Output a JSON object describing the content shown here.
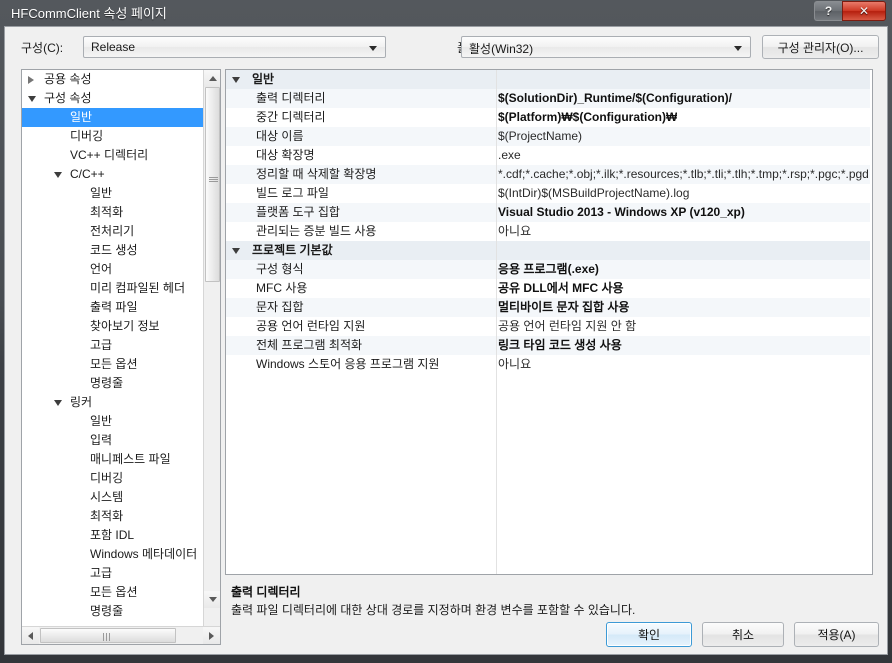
{
  "window": {
    "title": "HFCommClient 속성 페이지",
    "help_label": "?",
    "close_label": "✕"
  },
  "top": {
    "config_label": "구성(C):",
    "config_value": "Release",
    "platform_label": "플랫폼(P):",
    "platform_value": "활성(Win32)",
    "config_manager_label": "구성 관리자(O)..."
  },
  "tree": {
    "items": [
      {
        "label": "공용 속성",
        "indent": 22,
        "expander": "closed",
        "selected": false
      },
      {
        "label": "구성 속성",
        "indent": 22,
        "expander": "open",
        "selected": false
      },
      {
        "label": "일반",
        "indent": 48,
        "expander": "none",
        "selected": true
      },
      {
        "label": "디버깅",
        "indent": 48,
        "expander": "none",
        "selected": false
      },
      {
        "label": "VC++ 디렉터리",
        "indent": 48,
        "expander": "none",
        "selected": false
      },
      {
        "label": "C/C++",
        "indent": 48,
        "expander": "open",
        "selected": false
      },
      {
        "label": "일반",
        "indent": 68,
        "expander": "none",
        "selected": false
      },
      {
        "label": "최적화",
        "indent": 68,
        "expander": "none",
        "selected": false
      },
      {
        "label": "전처리기",
        "indent": 68,
        "expander": "none",
        "selected": false
      },
      {
        "label": "코드 생성",
        "indent": 68,
        "expander": "none",
        "selected": false
      },
      {
        "label": "언어",
        "indent": 68,
        "expander": "none",
        "selected": false
      },
      {
        "label": "미리 컴파일된 헤더",
        "indent": 68,
        "expander": "none",
        "selected": false
      },
      {
        "label": "출력 파일",
        "indent": 68,
        "expander": "none",
        "selected": false
      },
      {
        "label": "찾아보기 정보",
        "indent": 68,
        "expander": "none",
        "selected": false
      },
      {
        "label": "고급",
        "indent": 68,
        "expander": "none",
        "selected": false
      },
      {
        "label": "모든 옵션",
        "indent": 68,
        "expander": "none",
        "selected": false
      },
      {
        "label": "명령줄",
        "indent": 68,
        "expander": "none",
        "selected": false
      },
      {
        "label": "링커",
        "indent": 48,
        "expander": "open",
        "selected": false
      },
      {
        "label": "일반",
        "indent": 68,
        "expander": "none",
        "selected": false
      },
      {
        "label": "입력",
        "indent": 68,
        "expander": "none",
        "selected": false
      },
      {
        "label": "매니페스트 파일",
        "indent": 68,
        "expander": "none",
        "selected": false
      },
      {
        "label": "디버깅",
        "indent": 68,
        "expander": "none",
        "selected": false
      },
      {
        "label": "시스템",
        "indent": 68,
        "expander": "none",
        "selected": false
      },
      {
        "label": "최적화",
        "indent": 68,
        "expander": "none",
        "selected": false
      },
      {
        "label": "포함 IDL",
        "indent": 68,
        "expander": "none",
        "selected": false
      },
      {
        "label": "Windows 메타데이터",
        "indent": 68,
        "expander": "none",
        "selected": false
      },
      {
        "label": "고급",
        "indent": 68,
        "expander": "none",
        "selected": false
      },
      {
        "label": "모든 옵션",
        "indent": 68,
        "expander": "none",
        "selected": false
      },
      {
        "label": "명령줄",
        "indent": 68,
        "expander": "none",
        "selected": false
      }
    ]
  },
  "grid": {
    "rows": [
      {
        "kind": "section",
        "name": "일반",
        "value": "",
        "bold": false
      },
      {
        "kind": "prop",
        "name": "출력 디렉터리",
        "value": "$(SolutionDir)_Runtime/$(Configuration)/",
        "bold": true
      },
      {
        "kind": "prop",
        "name": "중간 디렉터리",
        "value": "$(Platform)₩$(Configuration)₩",
        "bold": true
      },
      {
        "kind": "prop",
        "name": "대상 이름",
        "value": "$(ProjectName)",
        "bold": false
      },
      {
        "kind": "prop",
        "name": "대상 확장명",
        "value": ".exe",
        "bold": false
      },
      {
        "kind": "prop",
        "name": "정리할 때 삭제할 확장명",
        "value": "*.cdf;*.cache;*.obj;*.ilk;*.resources;*.tlb;*.tli;*.tlh;*.tmp;*.rsp;*.pgc;*.pgd",
        "bold": false
      },
      {
        "kind": "prop",
        "name": "빌드 로그 파일",
        "value": "$(IntDir)$(MSBuildProjectName).log",
        "bold": false
      },
      {
        "kind": "prop",
        "name": "플랫폼 도구 집합",
        "value": "Visual Studio 2013 - Windows XP (v120_xp)",
        "bold": true
      },
      {
        "kind": "prop",
        "name": "관리되는 증분 빌드 사용",
        "value": "아니요",
        "bold": false
      },
      {
        "kind": "section",
        "name": "프로젝트 기본값",
        "value": "",
        "bold": false
      },
      {
        "kind": "prop",
        "name": "구성 형식",
        "value": "응용 프로그램(.exe)",
        "bold": true
      },
      {
        "kind": "prop",
        "name": "MFC 사용",
        "value": "공유 DLL에서 MFC 사용",
        "bold": true
      },
      {
        "kind": "prop",
        "name": "문자 집합",
        "value": "멀티바이트 문자 집합 사용",
        "bold": true
      },
      {
        "kind": "prop",
        "name": "공용 언어 런타임 지원",
        "value": "공용 언어 런타임 지원 안 함",
        "bold": false
      },
      {
        "kind": "prop",
        "name": "전체 프로그램 최적화",
        "value": "링크 타임 코드 생성 사용",
        "bold": true
      },
      {
        "kind": "prop",
        "name": "Windows 스토어 응용 프로그램 지원",
        "value": "아니요",
        "bold": false
      }
    ]
  },
  "description": {
    "title": "출력 디렉터리",
    "body": "출력 파일 디렉터리에 대한 상대 경로를 지정하며 환경 변수를 포함할 수 있습니다."
  },
  "footer": {
    "ok_label": "확인",
    "cancel_label": "취소",
    "apply_label": "적용(A)"
  },
  "colors": {
    "selection_blue": "#3399ff",
    "close_red": "#cf3a26",
    "titlebar_dark": "#494d52",
    "grid_alt_row": "#f4f7fa",
    "grid_section": "#e9eef3"
  }
}
